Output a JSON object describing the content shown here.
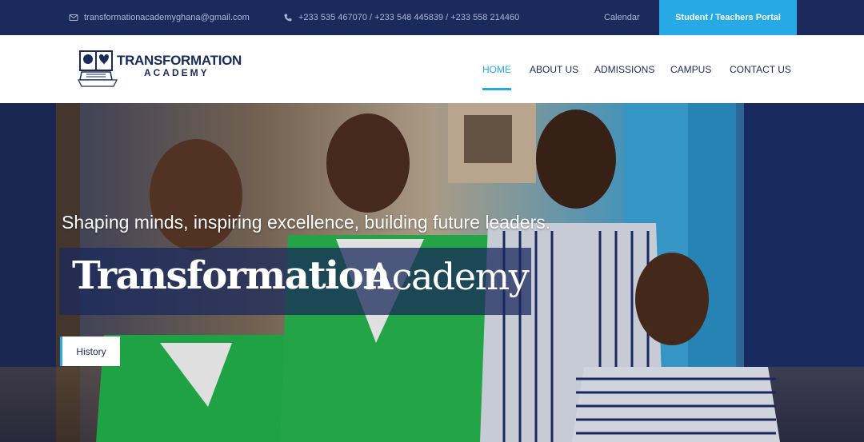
{
  "topbar": {
    "email": "transformationacademyghana@gmail.com",
    "phones": "+233 535 467070 / +233 548 445839 / +233 558 214460",
    "calendar_label": "Calendar",
    "portal_label": "Student / Teachers Portal",
    "icons": {
      "email": "envelope-icon",
      "phone": "phone-icon"
    }
  },
  "logo": {
    "line1": "TRANSFORMATION",
    "line2": "ACADEMY"
  },
  "nav": {
    "items": [
      {
        "label": "HOME",
        "active": true
      },
      {
        "label": "ABOUT US",
        "active": false
      },
      {
        "label": "ADMISSIONS",
        "active": false
      },
      {
        "label": "CAMPUS",
        "active": false
      },
      {
        "label": "CONTACT US",
        "active": false
      }
    ]
  },
  "hero": {
    "tagline": "Shaping minds, inspiring excellence, building future leaders.",
    "title_bold": "Transformation",
    "title_regular": "Academy",
    "button_label": "History"
  },
  "colors": {
    "navy": "#1b2a5c",
    "accent": "#27a9e6",
    "white": "#ffffff"
  }
}
